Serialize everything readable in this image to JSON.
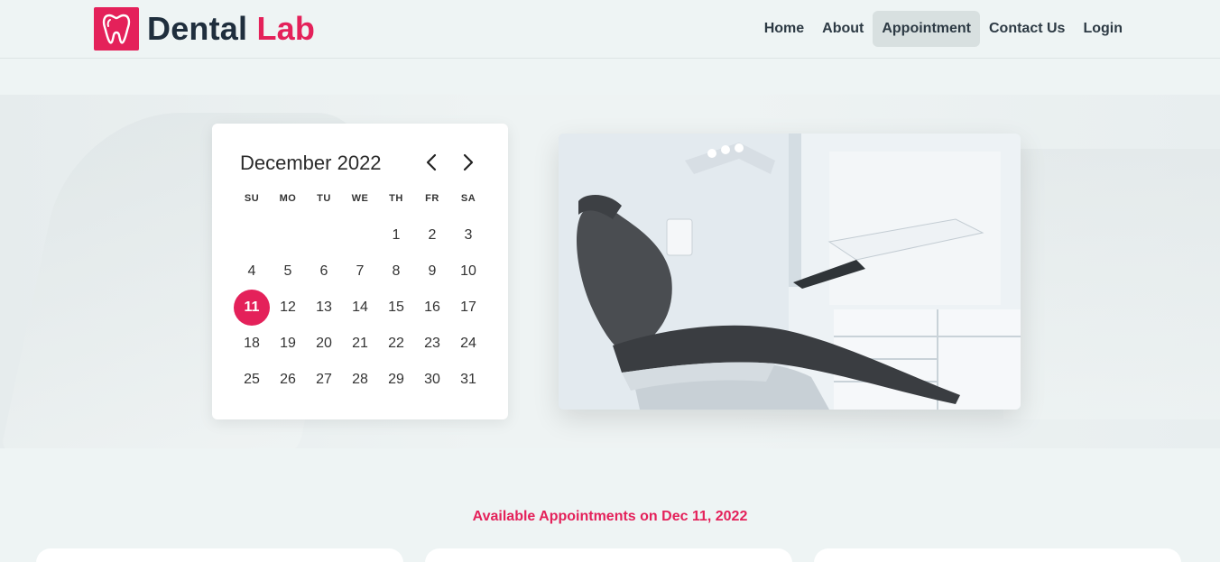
{
  "header": {
    "logo_main": "Dental",
    "logo_accent": "Lab",
    "nav": [
      {
        "label": "Home"
      },
      {
        "label": "About"
      },
      {
        "label": "Appointment",
        "active": true
      },
      {
        "label": "Contact Us"
      },
      {
        "label": "Login"
      }
    ]
  },
  "calendar": {
    "month_label": "December 2022",
    "weekdays": [
      "SU",
      "MO",
      "TU",
      "WE",
      "TH",
      "FR",
      "SA"
    ],
    "leading_blanks": 4,
    "days": [
      "1",
      "2",
      "3",
      "4",
      "5",
      "6",
      "7",
      "8",
      "9",
      "10",
      "11",
      "12",
      "13",
      "14",
      "15",
      "16",
      "17",
      "18",
      "19",
      "20",
      "21",
      "22",
      "23",
      "24",
      "25",
      "26",
      "27",
      "28",
      "29",
      "30",
      "31"
    ],
    "selected_day": "11"
  },
  "appointments": {
    "title": "Available Appointments on Dec 11, 2022"
  },
  "colors": {
    "accent": "#e4215a",
    "dark": "#1f2e3d",
    "background": "#eef4f4"
  }
}
